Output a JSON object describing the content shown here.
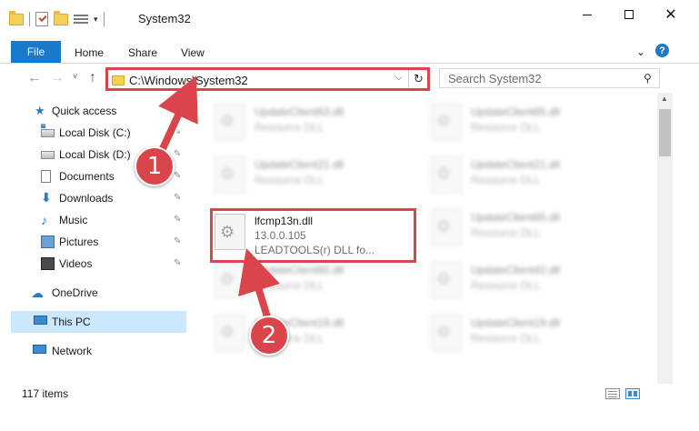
{
  "window": {
    "title": "System32",
    "minimize_icon": "minimize-icon",
    "maximize_icon": "maximize-icon",
    "close_icon": "close-icon",
    "close_glyph": "✕"
  },
  "ribbon": {
    "tabs": [
      "File",
      "Home",
      "Share",
      "View"
    ],
    "expand_glyph": "⌄",
    "help_glyph": "?"
  },
  "navigation": {
    "back_glyph": "←",
    "forward_glyph": "→",
    "recent_glyph": "˅",
    "up_glyph": "↑",
    "address": "C:\\Windows\\System32",
    "address_dropdown_glyph": "⌵",
    "refresh_glyph": "↻",
    "search_placeholder": "Search System32",
    "search_glyph": "⚲"
  },
  "sidebar": {
    "quick_access": "Quick access",
    "items": [
      {
        "label": "Local Disk (C:)",
        "icon": "drive-icon",
        "pinned": true
      },
      {
        "label": "Local Disk (D:)",
        "icon": "drive-icon",
        "pinned": true
      },
      {
        "label": "Documents",
        "icon": "documents-icon",
        "pinned": true
      },
      {
        "label": "Downloads",
        "icon": "downloads-icon",
        "pinned": true
      },
      {
        "label": "Music",
        "icon": "music-icon",
        "pinned": true
      },
      {
        "label": "Pictures",
        "icon": "pictures-icon",
        "pinned": true
      },
      {
        "label": "Videos",
        "icon": "videos-icon",
        "pinned": true
      }
    ],
    "onedrive": "OneDrive",
    "this_pc": "This PC",
    "network": "Network",
    "pin_glyph": "📌"
  },
  "files": {
    "left_column": [
      {
        "name": "UpdateClient63.dll",
        "desc": "Resource DLL"
      },
      {
        "name": "UpdateClient21.dll",
        "desc": "Resource DLL"
      },
      {
        "name": "UpdateClient65.dll",
        "desc": "Resource DLL"
      },
      {
        "name": "UpdateClient19.dll",
        "desc": "Resource DLL"
      }
    ],
    "right_column": [
      {
        "name": "UpdateClient65.dll",
        "desc": "Resource DLL"
      },
      {
        "name": "UpdateClient21.dll",
        "desc": "Resource DLL"
      },
      {
        "name": "UpdateClient65.dll",
        "desc": "Resource DLL"
      },
      {
        "name": "UpdateClient42.dll",
        "desc": "Resource DLL"
      },
      {
        "name": "UpdateClient19.dll",
        "desc": "Resource DLL"
      }
    ],
    "selected": {
      "name": "lfcmp13n.dll",
      "version": "13.0.0.105",
      "company": "LEADTOOLS(r) DLL fo..."
    }
  },
  "status": {
    "item_count": "117 items"
  },
  "annotations": {
    "step1": "1",
    "step2": "2",
    "color": "#d9454a"
  },
  "colors": {
    "accent": "#1979ca",
    "selection": "#cce8ff",
    "highlight": "#d9454a"
  }
}
